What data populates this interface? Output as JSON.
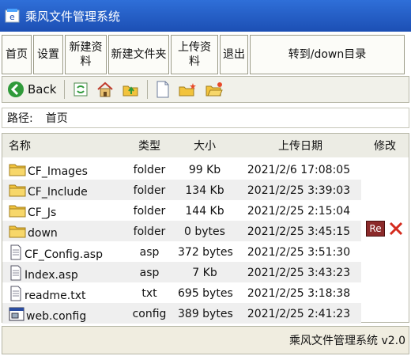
{
  "window": {
    "title": "乘风文件管理系统",
    "icon": "app-window-icon"
  },
  "menu": [
    {
      "id": "home",
      "label": "首页"
    },
    {
      "id": "settings",
      "label": "设置"
    },
    {
      "id": "new-folder-res",
      "label": "新建资\n料"
    },
    {
      "id": "new-folder",
      "label": "新建文件夹"
    },
    {
      "id": "upload",
      "label": "上传资\n料"
    },
    {
      "id": "exit",
      "label": "退出"
    },
    {
      "id": "goto-down",
      "label": "转到/down目录"
    }
  ],
  "toolbar": {
    "back_label": "Back",
    "icons": [
      "back-icon",
      "refresh-icon",
      "home-icon",
      "up-folder-icon",
      "new-file-icon",
      "new-folder-icon",
      "open-folder-icon"
    ]
  },
  "path": {
    "label": "路径:",
    "value": "首页"
  },
  "table": {
    "headers": {
      "name": "名称",
      "type": "类型",
      "size": "大小",
      "date": "上传日期",
      "edit": "修改"
    },
    "rows": [
      {
        "name": "CF_Images",
        "type": "folder",
        "size": "99  Kb",
        "date": "2021/2/6 17:08:05",
        "icon": "folder-icon"
      },
      {
        "name": "CF_Include",
        "type": "folder",
        "size": "134  Kb",
        "date": "2021/2/25 3:39:03",
        "icon": "folder-icon"
      },
      {
        "name": "CF_Js",
        "type": "folder",
        "size": "144 Kb",
        "date": "2021/2/25 2:15:04",
        "icon": "folder-icon"
      },
      {
        "name": "down",
        "type": "folder",
        "size": "0 bytes",
        "date": "2021/2/25 3:45:15",
        "icon": "folder-icon"
      },
      {
        "name": "CF_Config.asp",
        "type": "asp",
        "size": "372 bytes",
        "date": "2021/2/25 3:51:30",
        "icon": "file-icon"
      },
      {
        "name": "Index.asp",
        "type": "asp",
        "size": "7 Kb",
        "date": "2021/2/25 3:43:23",
        "icon": "file-icon"
      },
      {
        "name": "readme.txt",
        "type": "txt",
        "size": "695 bytes",
        "date": "2021/2/25 3:18:38",
        "icon": "file-icon"
      },
      {
        "name": "web.config",
        "type": "config",
        "size": "389 bytes",
        "date": "2021/2/25 2:41:23",
        "icon": "config-file-icon"
      }
    ],
    "row_actions": {
      "rename_label": "Re",
      "delete_icon": "delete-x-icon"
    }
  },
  "status": {
    "text": "乘风文件管理系统 v2.0"
  },
  "colors": {
    "titlebar": "#2a64cc",
    "folder": "#f2c33c",
    "delete": "#d42b1e",
    "rename": "#8b2a2a"
  }
}
